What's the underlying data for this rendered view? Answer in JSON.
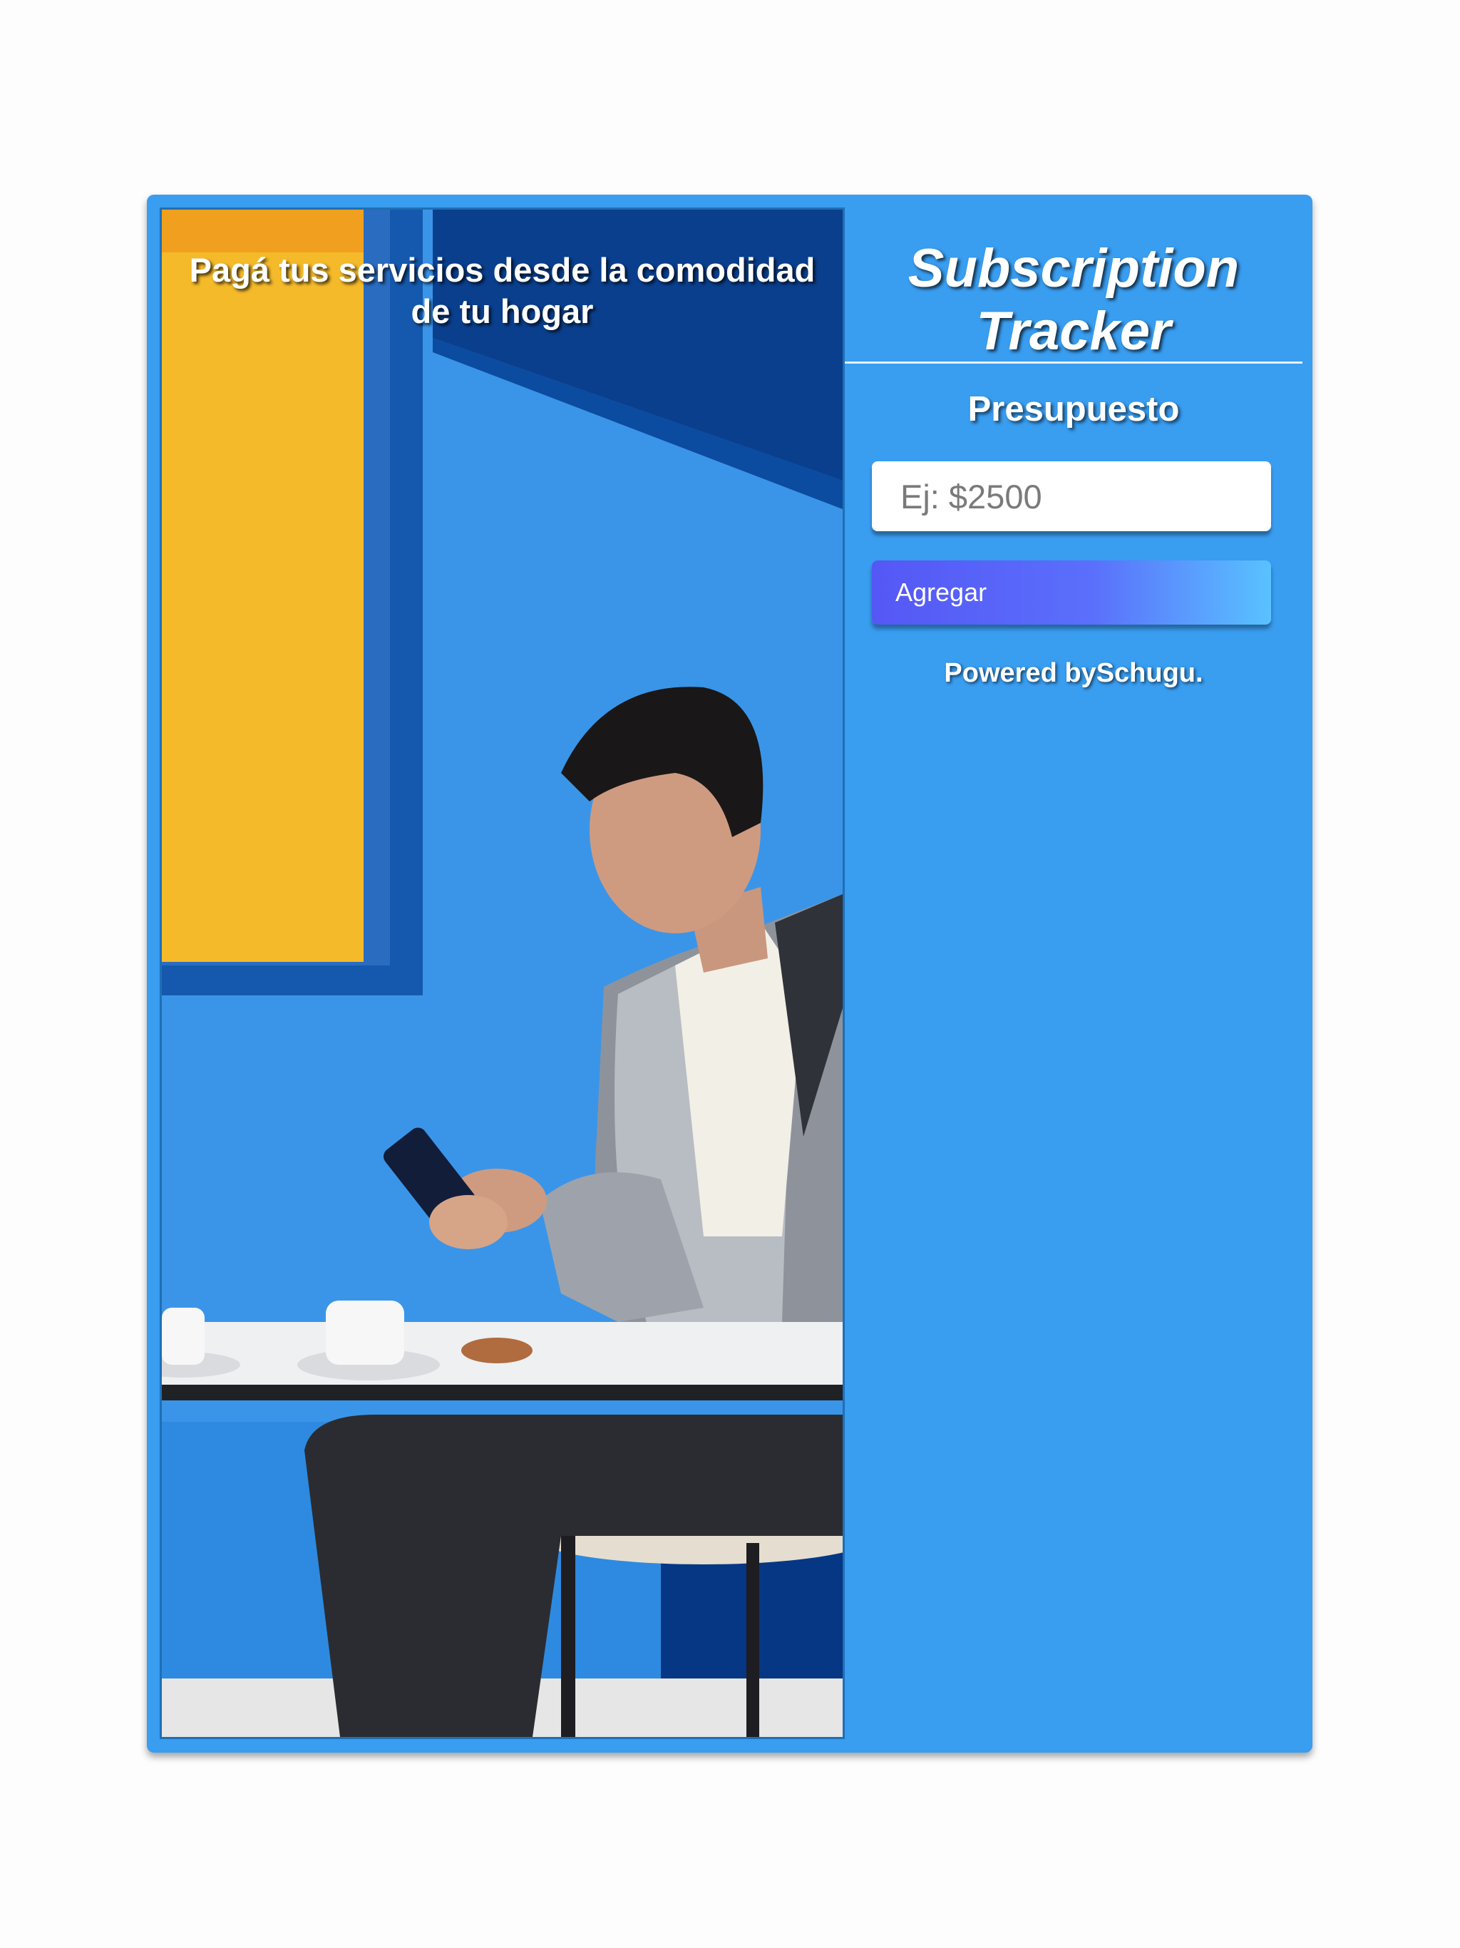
{
  "hero": {
    "caption": "Pagá tus servicios desde la comodidad de tu hogar"
  },
  "header": {
    "title": "Subscription Tracker"
  },
  "budget": {
    "label": "Presupuesto",
    "placeholder": "Ej: $2500",
    "value": "",
    "add_label": "Agregar"
  },
  "footer": {
    "credit": "Powered bySchugu."
  },
  "colors": {
    "card_background": "#399df0",
    "page_background": "#fdfdfd",
    "button_gradient_start": "#5557f5",
    "button_gradient_end": "#59c2ff"
  }
}
